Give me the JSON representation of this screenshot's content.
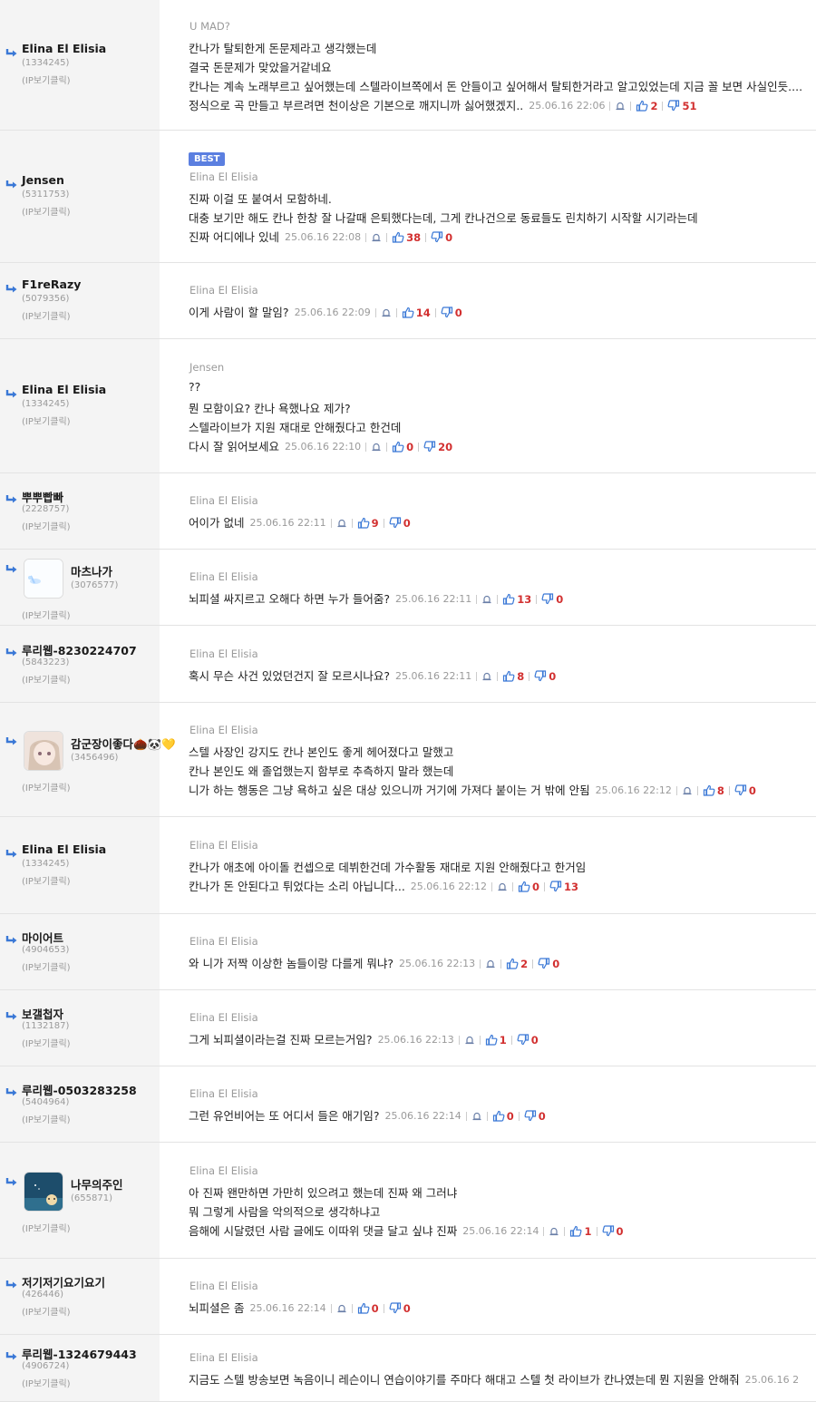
{
  "common": {
    "ip_label": "(IP보기클릭)",
    "best_label": "BEST"
  },
  "colors": {
    "accent_blue": "#3a78d6",
    "vote_red": "#d23030",
    "meta_gray": "#9a9a9a",
    "panel_gray": "#f4f4f4",
    "best_bg": "#5b7fe0"
  },
  "icons": {
    "reply_arrow": "reply-arrow-icon",
    "report": "bell-report-icon",
    "upvote": "thumbs-up-icon",
    "downvote": "thumbs-down-icon"
  },
  "comments": [
    {
      "author": "Elina El Elisia",
      "uid": "(1334245)",
      "reply_to": "U MAD?",
      "lines": [
        "칸나가 탈퇴한게 돈문제라고 생각했는데",
        "결국 돈문제가 맞았을거같네요",
        "칸나는 계속 노래부르고 싶어했는데 스텔라이브쪽에서 돈 안들이고 싶어해서 탈퇴한거라고 알고있었는데 지금 꼴 보면 사실인듯....",
        "정식으로 곡 만들고 부르려면 천이상은 기본으로 깨지니까 싫어했겠지.."
      ],
      "date": "25.06.16 22:06",
      "up": "2",
      "down": "51"
    },
    {
      "author": "Jensen",
      "uid": "(5311753)",
      "best": true,
      "reply_to": "Elina El Elisia",
      "lines": [
        "진짜 이걸 또 붙여서 모함하네.",
        "대충 보기만 해도 칸나 한창 잘 나갈때 은퇴했다는데, 그게 칸나건으로 동료들도 린치하기 시작할 시기라는데",
        "진짜 어디에나 있네"
      ],
      "date": "25.06.16 22:08",
      "up": "38",
      "down": "0"
    },
    {
      "author": "F1reRazy",
      "uid": "(5079356)",
      "reply_to": "Elina El Elisia",
      "lines": [
        "이게 사람이 할 말임?"
      ],
      "date": "25.06.16 22:09",
      "up": "14",
      "down": "0"
    },
    {
      "author": "Elina El Elisia",
      "uid": "(1334245)",
      "reply_to": "Jensen",
      "lines": [
        "??",
        "뭔 모함이요? 칸나 욕했나요 제가?",
        "스텔라이브가 지원 재대로 안해줬다고 한건데",
        "다시 잘 읽어보세요"
      ],
      "date": "25.06.16 22:10",
      "up": "0",
      "down": "20"
    },
    {
      "author": "뿌뿌빱빠",
      "uid": "(2228757)",
      "reply_to": "Elina El Elisia",
      "lines": [
        "어이가 없네"
      ],
      "date": "25.06.16 22:11",
      "up": "9",
      "down": "0"
    },
    {
      "author": "마츠나가",
      "uid": "(3076577)",
      "avatar": "cloud",
      "reply_to": "Elina El Elisia",
      "lines": [
        "뇌피셜 싸지르고 오해다 하면 누가 들어줌?"
      ],
      "date": "25.06.16 22:11",
      "up": "13",
      "down": "0"
    },
    {
      "author": "루리웹-8230224707",
      "uid": "(5843223)",
      "reply_to": "Elina El Elisia",
      "lines": [
        "혹시 무슨 사건 있었던건지 잘 모르시나요?"
      ],
      "date": "25.06.16 22:11",
      "up": "8",
      "down": "0"
    },
    {
      "author": "감군장이좋다🌰🐼💛",
      "uid": "(3456496)",
      "avatar": "girl",
      "reply_to": "Elina El Elisia",
      "lines": [
        "스텔 사장인 강지도 칸나 본인도 좋게 헤어졌다고 말했고",
        "칸나 본인도 왜 졸업했는지 함부로 추측하지 말라 했는데",
        "니가 하는 행동은 그냥 욕하고 싶은 대상 있으니까 거기에 가져다 붙이는 거 밖에 안됨"
      ],
      "date": "25.06.16 22:12",
      "up": "8",
      "down": "0"
    },
    {
      "author": "Elina El Elisia",
      "uid": "(1334245)",
      "reply_to": "Elina El Elisia",
      "lines": [
        "칸나가 애초에 아이돌 컨셉으로 데뷔한건데 가수활동 재대로 지원 안해줬다고 한거임",
        "칸나가 돈 안된다고 튀었다는 소리 아닙니다..."
      ],
      "date": "25.06.16 22:12",
      "up": "0",
      "down": "13"
    },
    {
      "author": "마이어트",
      "uid": "(4904653)",
      "reply_to": "Elina El Elisia",
      "lines": [
        "와 니가 저짝 이상한 놈들이랑 다를게 뭐냐?"
      ],
      "date": "25.06.16 22:13",
      "up": "2",
      "down": "0"
    },
    {
      "author": "보갤첩자",
      "uid": "(1132187)",
      "reply_to": "Elina El Elisia",
      "lines": [
        "그게 뇌피셜이라는걸 진짜 모르는거임?"
      ],
      "date": "25.06.16 22:13",
      "up": "1",
      "down": "0"
    },
    {
      "author": "루리웹-0503283258",
      "uid": "(5404964)",
      "reply_to": "Elina El Elisia",
      "lines": [
        "그런 유언비어는 또 어디서 들은 애기임?"
      ],
      "date": "25.06.16 22:14",
      "up": "0",
      "down": "0"
    },
    {
      "author": "나무의주인",
      "uid": "(655871)",
      "avatar": "tree",
      "reply_to": "Elina El Elisia",
      "lines": [
        "아 진짜 왠만하면 가만히 있으려고 했는데 진짜 왜 그러냐",
        "뭐 그렇게 사람을 악의적으로 생각하냐고",
        "음해에 시달렸던 사람 글에도 이따위 댓글 달고 싶냐 진짜"
      ],
      "date": "25.06.16 22:14",
      "up": "1",
      "down": "0"
    },
    {
      "author": "저기저기요기요기",
      "uid": "(426446)",
      "reply_to": "Elina El Elisia",
      "lines": [
        "뇌피셜은 좀"
      ],
      "date": "25.06.16 22:14",
      "up": "0",
      "down": "0"
    },
    {
      "author": "루리웹-1324679443",
      "uid": "(4906724)",
      "reply_to": "Elina El Elisia",
      "lines": [
        "지금도 스텔 방송보면 녹음이니 레슨이니 연습이야기를 주마다 해대고 스텔 첫 라이브가 칸나였는데 뭔 지원을 안해줘"
      ],
      "date": "25.06.16 2",
      "up": "",
      "down": ""
    }
  ]
}
